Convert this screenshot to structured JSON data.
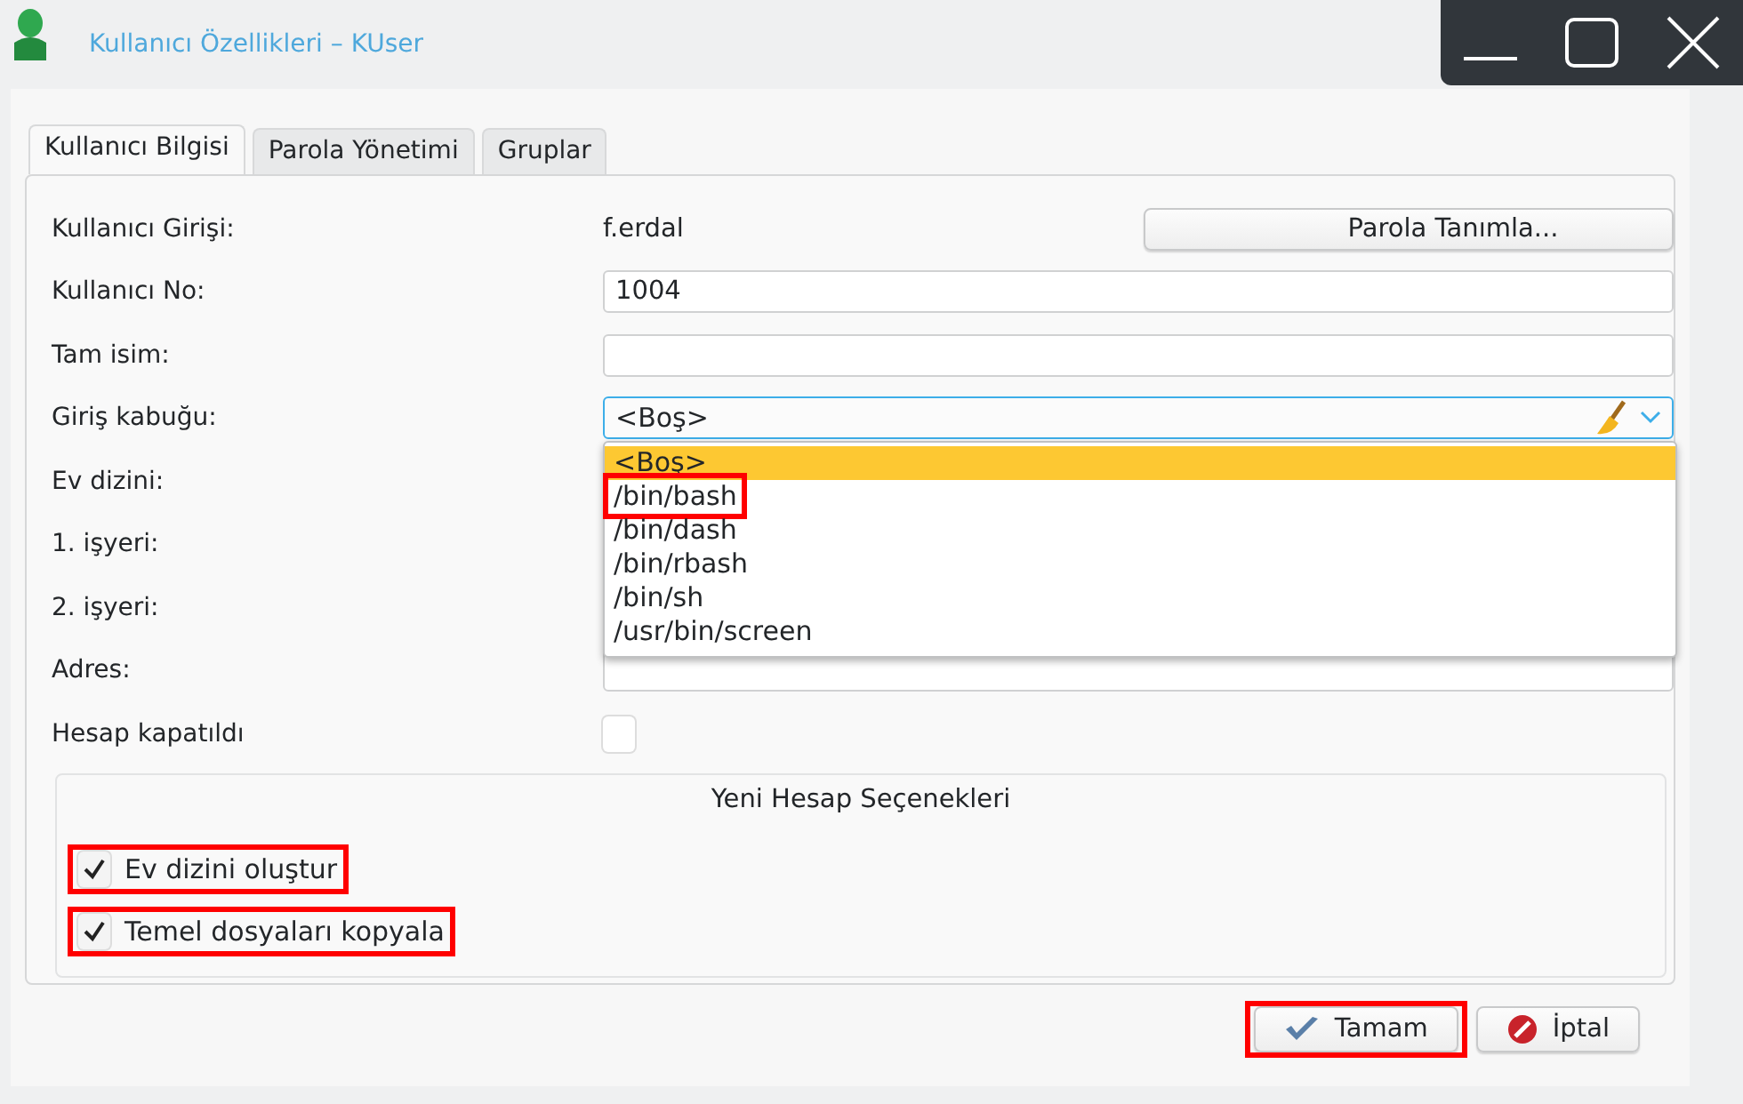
{
  "window": {
    "title": "Kullanıcı Özellikleri – KUser"
  },
  "tabs": [
    {
      "label": "Kullanıcı Bilgisi",
      "selected": true
    },
    {
      "label": "Parola Yönetimi",
      "selected": false
    },
    {
      "label": "Gruplar",
      "selected": false
    }
  ],
  "fields": [
    {
      "kind": "text",
      "label": "Kullanıcı Girişi:",
      "value": "f.erdal",
      "button": "Parola Tanımla..."
    },
    {
      "kind": "field",
      "label": "Kullanıcı No:",
      "value": "1004"
    },
    {
      "kind": "field",
      "label": "Tam isim:"
    },
    {
      "kind": "combo",
      "label": "Giriş kabuğu:",
      "value": "<Boş>",
      "expanded": true
    },
    {
      "kind": "covered",
      "label": "Ev dizini:"
    },
    {
      "kind": "covered",
      "label": "1. işyeri:"
    },
    {
      "kind": "covered",
      "label": "2. işyeri:"
    },
    {
      "kind": "field",
      "label": "Adres:"
    },
    {
      "kind": "checkbox",
      "label": "Hesap kapatıldı",
      "checked": false
    }
  ],
  "dropdown": {
    "options": [
      {
        "label": "<Boş>",
        "selected": true,
        "highlighted": false
      },
      {
        "label": "/bin/bash",
        "selected": false,
        "highlighted": true
      },
      {
        "label": "/bin/dash",
        "selected": false,
        "highlighted": false
      },
      {
        "label": "/bin/rbash",
        "selected": false,
        "highlighted": false
      },
      {
        "label": "/bin/sh",
        "selected": false,
        "highlighted": false
      },
      {
        "label": "/usr/bin/screen",
        "selected": false,
        "highlighted": false
      }
    ]
  },
  "new_account": {
    "title": "Yeni Hesap Seçenekleri",
    "options": [
      {
        "label": "Ev dizini oluştur",
        "checked": true,
        "highlighted": true
      },
      {
        "label": "Temel dosyaları kopyala",
        "checked": true,
        "highlighted": true
      }
    ]
  },
  "buttons": [
    {
      "kind": "ok",
      "label": "Tamam",
      "highlighted": true
    },
    {
      "kind": "cancel",
      "label": "İptal",
      "highlighted": false
    }
  ]
}
